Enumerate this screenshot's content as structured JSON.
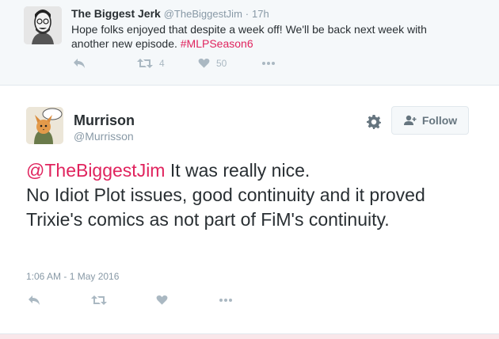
{
  "parent_tweet": {
    "name": "The Biggest Jerk",
    "handle": "@TheBiggestJim",
    "separator": "·",
    "time": "17h",
    "text": "Hope folks enjoyed that despite a week off! We'll be back next week with another new episode. ",
    "hashtag": "#MLPSeason6",
    "retweet_count": "4",
    "like_count": "50",
    "icons": [
      "reply-icon",
      "retweet-icon",
      "heart-icon",
      "more-icon"
    ]
  },
  "main_tweet": {
    "name": "Murrison",
    "handle": "@Murrisson",
    "follow_label": "Follow",
    "mention": "@TheBiggestJim",
    "text_line1": " It was really nice.",
    "text_rest": "No Idiot Plot issues, good continuity and it proved Trixie's comics as not part of FiM's continuity.",
    "timestamp": "1:06 AM - 1 May 2016",
    "icons": [
      "gear-icon",
      "follow-person-icon",
      "reply-icon",
      "retweet-icon",
      "heart-icon",
      "more-icon"
    ]
  },
  "colors": {
    "link_red": "#e0245e",
    "muted": "#8899a6",
    "icon_grey": "#aab8c2",
    "text": "#292f33",
    "parent_bg": "#f5f8fa"
  }
}
